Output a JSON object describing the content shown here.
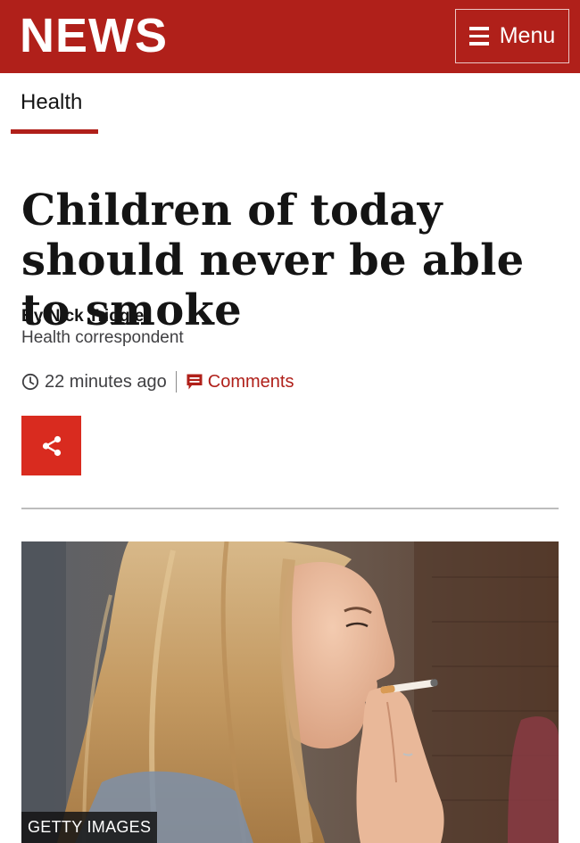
{
  "header": {
    "logo": "NEWS",
    "menu_label": "Menu",
    "background_color": "#b0201a"
  },
  "section": {
    "label": "Health"
  },
  "article": {
    "headline": "Children of today should never be able to smoke",
    "author": "By Nick Triggle",
    "author_role": "Health correspondent",
    "timestamp": "22 minutes ago",
    "comments_label": "Comments",
    "share_icon": "share-icon",
    "accent_color": "#d92b1f"
  },
  "hero_image": {
    "credit": "GETTY IMAGES",
    "subject": "young woman with long blonde hair smoking a cigarette"
  }
}
